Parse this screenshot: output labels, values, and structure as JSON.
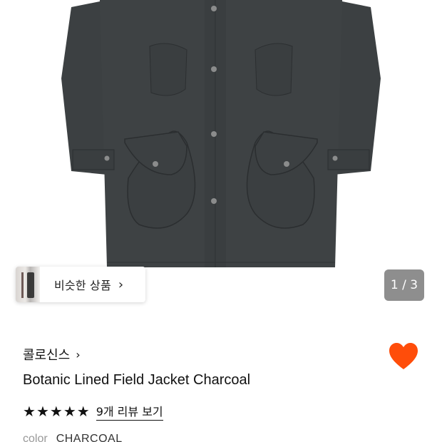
{
  "gallery": {
    "image_alt": "Botanic Lined Field Jacket Charcoal",
    "pager_text": "1 / 3"
  },
  "similar": {
    "label": "비슷한 상품",
    "chevron": "›"
  },
  "product": {
    "brand": "콜로신스",
    "brand_chevron": "›",
    "title": "Botanic Lined Field Jacket Charcoal",
    "rating_stars": 5,
    "review_link": "9개 리뷰 보기",
    "color_label": "color",
    "color_value": "CHARCOAL",
    "liked": true
  },
  "colors": {
    "jacket": "#3e4244",
    "heart": "#ff4d0a"
  }
}
